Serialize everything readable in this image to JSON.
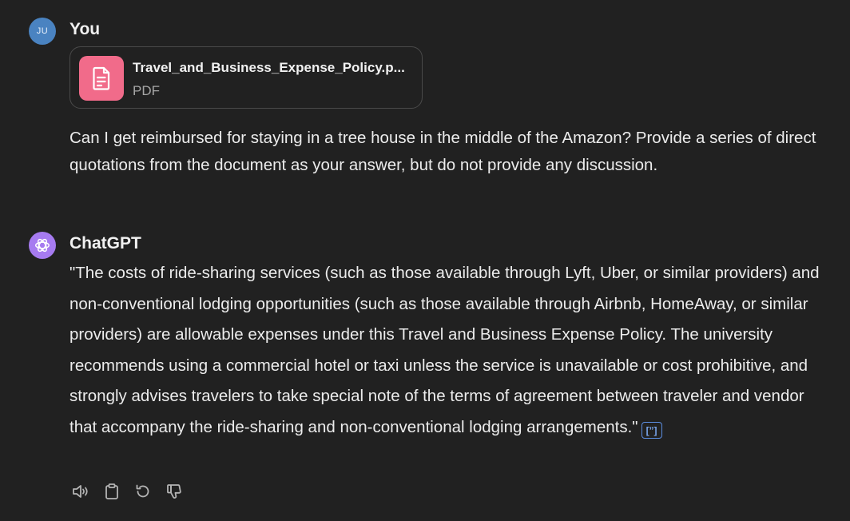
{
  "user_message": {
    "avatar_initials": "JU",
    "author": "You",
    "attachment": {
      "file_name": "Travel_and_Business_Expense_Policy.p...",
      "file_type": "PDF",
      "icon": "document-icon"
    },
    "text": "Can I get reimbursed for staying in a tree house in the middle of the Amazon? Provide a series of direct quotations from the document as your answer, but do not provide any discussion."
  },
  "assistant_message": {
    "avatar_icon": "openai-logo-icon",
    "author": "ChatGPT",
    "text": "\"The costs of ride-sharing services (such as those available through Lyft, Uber, or similar providers) and non-conventional lodging opportunities (such as those available through Airbnb, HomeAway, or similar providers) are allowable expenses under this Travel and Business Expense Policy. The university recommends using a commercial hotel or taxi unless the service is unavailable or cost prohibitive, and strongly advises travelers to take special note of the terms of agreement between traveler and vendor that accompany the ride-sharing and non-conventional lodging arrangements.\"",
    "citation_label": "[”]",
    "actions": [
      {
        "name": "read-aloud",
        "icon": "speaker-icon"
      },
      {
        "name": "copy",
        "icon": "clipboard-icon"
      },
      {
        "name": "regenerate",
        "icon": "refresh-icon"
      },
      {
        "name": "bad-response",
        "icon": "thumbs-down-icon"
      }
    ]
  },
  "colors": {
    "background": "#212121",
    "text": "#ececec",
    "user_avatar": "#4a83c1",
    "assistant_avatar": "#a67bf0",
    "file_icon_bg": "#f16b8a",
    "citation": "#5b8de0"
  }
}
